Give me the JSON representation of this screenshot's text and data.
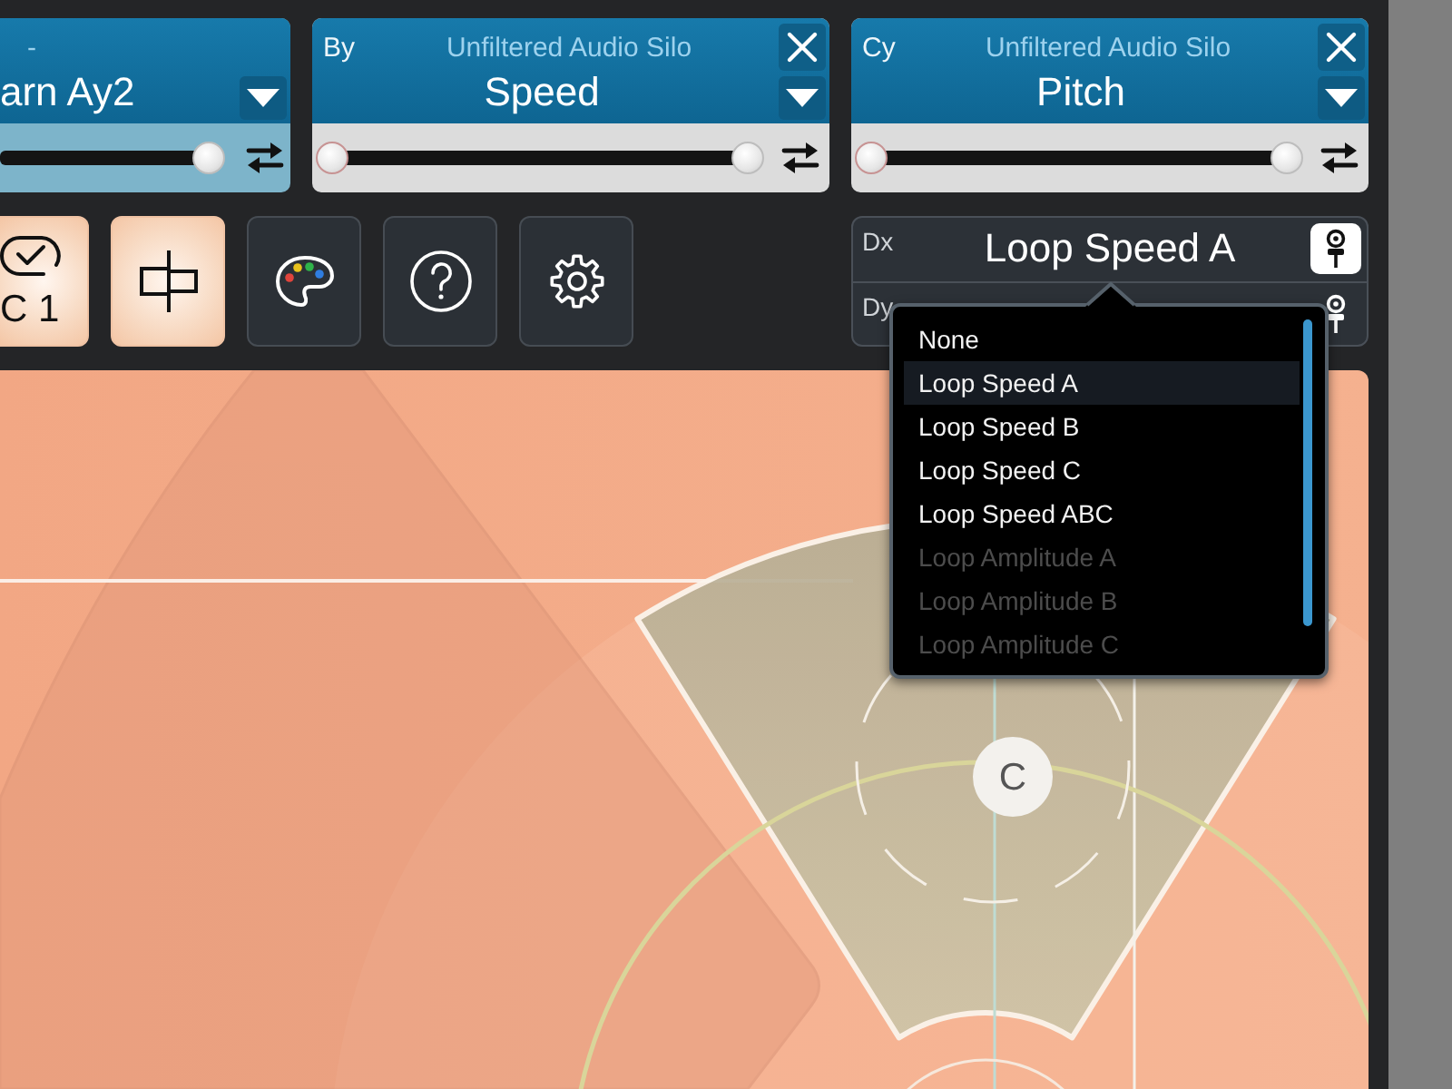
{
  "slots": [
    {
      "plugin": "-",
      "parameter": "arn Ay2",
      "selected": true,
      "closable": false,
      "range": {
        "high": {
          "level": 1
        }
      }
    },
    {
      "axis": "By",
      "plugin": "Unfiltered Audio Silo",
      "parameter": "Speed",
      "selected": false,
      "closable": true,
      "range": {
        "low": {
          "level": 0
        },
        "high": {
          "level": 1
        }
      }
    },
    {
      "axis": "Cy",
      "plugin": "Unfiltered Audio Silo",
      "parameter": "Pitch",
      "selected": false,
      "closable": true,
      "range": {
        "low": {
          "level": 0
        },
        "high": {
          "level": 1
        }
      }
    }
  ],
  "toolbar": [
    {
      "kind": "sync",
      "label": "C 1",
      "on": true
    },
    {
      "kind": "align",
      "on": true
    },
    {
      "kind": "palette",
      "on": false
    },
    {
      "kind": "help",
      "on": false
    },
    {
      "kind": "settings",
      "on": false
    }
  ],
  "mapping": {
    "rows": [
      {
        "axis": "Dx",
        "target": "Loop Speed A",
        "pinned": true
      },
      {
        "axis": "Dy",
        "pinned": false
      }
    ],
    "menu": {
      "options": [
        {
          "label": "None",
          "selected": false,
          "disabled": false
        },
        {
          "label": "Loop Speed A",
          "selected": true,
          "disabled": false
        },
        {
          "label": "Loop Speed B",
          "selected": false,
          "disabled": false
        },
        {
          "label": "Loop Speed C",
          "selected": false,
          "disabled": false
        },
        {
          "label": "Loop Speed ABC",
          "selected": false,
          "disabled": false
        },
        {
          "label": "Loop Amplitude A",
          "selected": false,
          "disabled": true
        },
        {
          "label": "Loop Amplitude B",
          "selected": false,
          "disabled": true
        },
        {
          "label": "Loop Amplitude C",
          "selected": false,
          "disabled": true
        }
      ]
    }
  },
  "canvas": {
    "node": {
      "label": "C"
    }
  }
}
